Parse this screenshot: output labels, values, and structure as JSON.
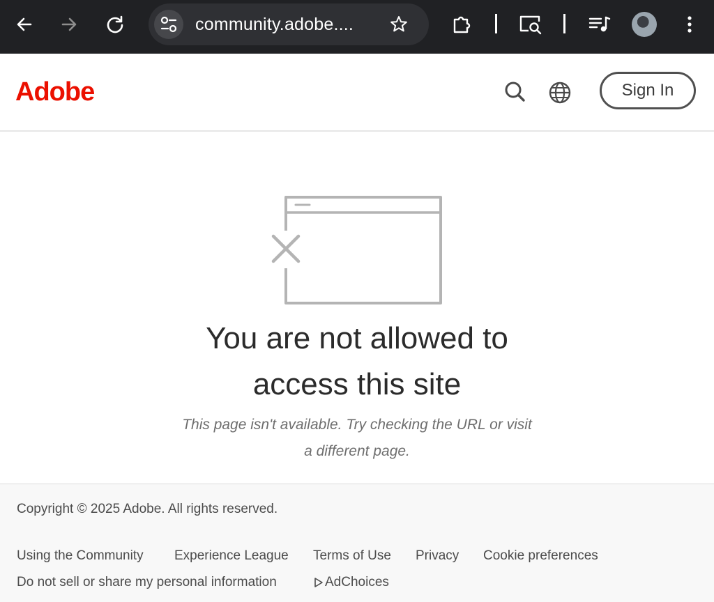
{
  "browser": {
    "url": "community.adobe....",
    "icons": [
      "back-arrow-icon",
      "forward-arrow-icon",
      "reload-icon",
      "site-settings-icon",
      "star-icon",
      "extensions-icon",
      "search-tab-icon",
      "media-queue-icon",
      "profile-avatar",
      "kebab-menu-icon"
    ]
  },
  "header": {
    "brand": "Adobe",
    "sign_in": "Sign In",
    "icons": [
      "search-icon",
      "globe-icon"
    ],
    "brand_color": "#eb1000"
  },
  "main": {
    "title_line1": "You are not allowed to",
    "title_line2": "access this site",
    "desc_line1": "This page isn't available. Try checking the URL or visit",
    "desc_line2": "a different page."
  },
  "footer": {
    "copyright": "Copyright © 2025 Adobe. All rights reserved.",
    "links": [
      "Using the Community",
      "Experience League",
      "Terms of Use",
      "Privacy",
      "Cookie preferences",
      "Do not sell or share my personal information",
      "AdChoices"
    ]
  }
}
